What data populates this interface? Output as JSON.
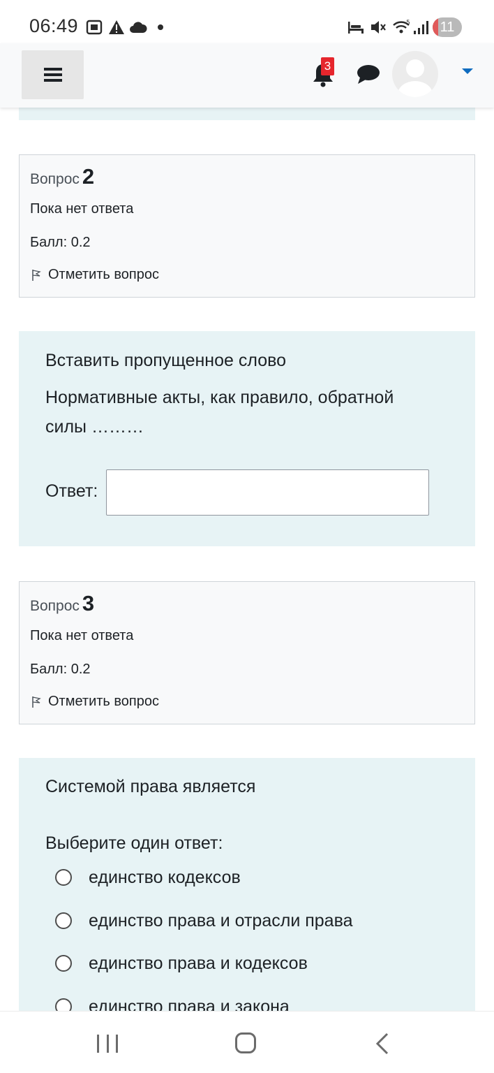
{
  "status_bar": {
    "time": "06:49",
    "notification_count": "11",
    "icons": [
      "screenshot-icon",
      "warning-icon",
      "cloud-icon",
      "dot-icon",
      "sleep-mode-icon",
      "mute-icon",
      "wifi-icon",
      "signal-icon"
    ]
  },
  "header": {
    "menu_icon": "hamburger-menu-icon",
    "notification_icon": "bell-icon",
    "notification_badge": "3",
    "messages_icon": "chat-icon",
    "user_menu_icon": "caret-down-icon",
    "accent_color": "#0f6cbf"
  },
  "questions": [
    {
      "info": {
        "label": "Вопрос",
        "number": "2",
        "state": "Пока нет ответа",
        "grade": "Балл: 0.2",
        "flag_label": "Отметить вопрос"
      },
      "content": {
        "prompt": "Вставить пропущенное слово",
        "text_line1": "Нормативные акты, как правило, обратной",
        "text_line2": "силы ………",
        "answer_label": "Ответ:",
        "answer_value": ""
      }
    },
    {
      "info": {
        "label": "Вопрос",
        "number": "3",
        "state": "Пока нет ответа",
        "grade": "Балл: 0.2",
        "flag_label": "Отметить вопрос"
      },
      "content": {
        "prompt": "Системой права является",
        "instruction": "Выберите один ответ:",
        "options": [
          "единство кодексов",
          "единство права и отрасли права",
          "единство права и кодексов",
          "единство права и закона"
        ]
      }
    }
  ],
  "colors": {
    "content_background": "#e7f3f5",
    "info_background": "#f8f9fa",
    "badge_red": "#e6262d"
  },
  "system_nav": {
    "recent_icon": "recent-apps-icon",
    "home_icon": "home-icon",
    "back_icon": "back-icon"
  }
}
